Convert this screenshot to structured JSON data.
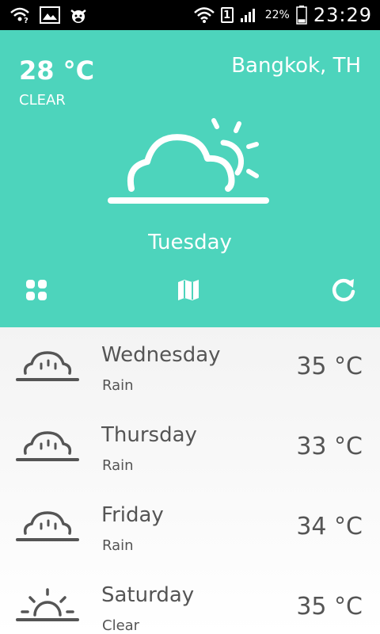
{
  "status_bar": {
    "battery_percent": "22%",
    "sim_slot": "1",
    "time": "23:29",
    "battery_level": 0.22
  },
  "current": {
    "temperature": "28 °C",
    "condition": "CLEAR",
    "location": "Bangkok, TH",
    "day": "Tuesday",
    "icon": "partly-cloudy-icon"
  },
  "toolbar": {
    "left_icon": "grid-icon",
    "center_icon": "map-icon",
    "right_icon": "refresh-icon"
  },
  "forecast": [
    {
      "day": "Wednesday",
      "condition": "Rain",
      "temperature": "35 °C",
      "icon": "rain-cloud-icon"
    },
    {
      "day": "Thursday",
      "condition": "Rain",
      "temperature": "33 °C",
      "icon": "rain-cloud-icon"
    },
    {
      "day": "Friday",
      "condition": "Rain",
      "temperature": "34 °C",
      "icon": "rain-cloud-icon"
    },
    {
      "day": "Saturday",
      "condition": "Clear",
      "temperature": "35 °C",
      "icon": "sunrise-icon"
    }
  ],
  "colors": {
    "accent": "#4dd4bc",
    "text_dark": "#555555",
    "status_bar": "#000000"
  }
}
